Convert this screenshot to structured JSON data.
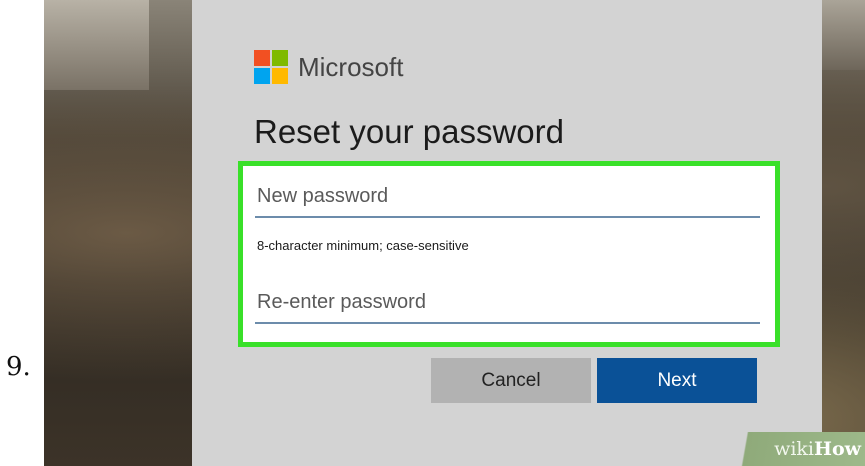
{
  "step": {
    "number": "9."
  },
  "brand": {
    "name": "Microsoft",
    "logo_colors": [
      "#f25022",
      "#7fba00",
      "#00a4ef",
      "#ffb900"
    ]
  },
  "dialog": {
    "title": "Reset your password",
    "new_password": {
      "placeholder": "New password",
      "value": ""
    },
    "hint": "8-character minimum; case-sensitive",
    "reenter_password": {
      "placeholder": "Re-enter password",
      "value": ""
    },
    "buttons": {
      "cancel": "Cancel",
      "next": "Next"
    }
  },
  "highlight": {
    "color": "#39e029"
  },
  "watermark": {
    "wiki": "wiki",
    "how": "How"
  }
}
